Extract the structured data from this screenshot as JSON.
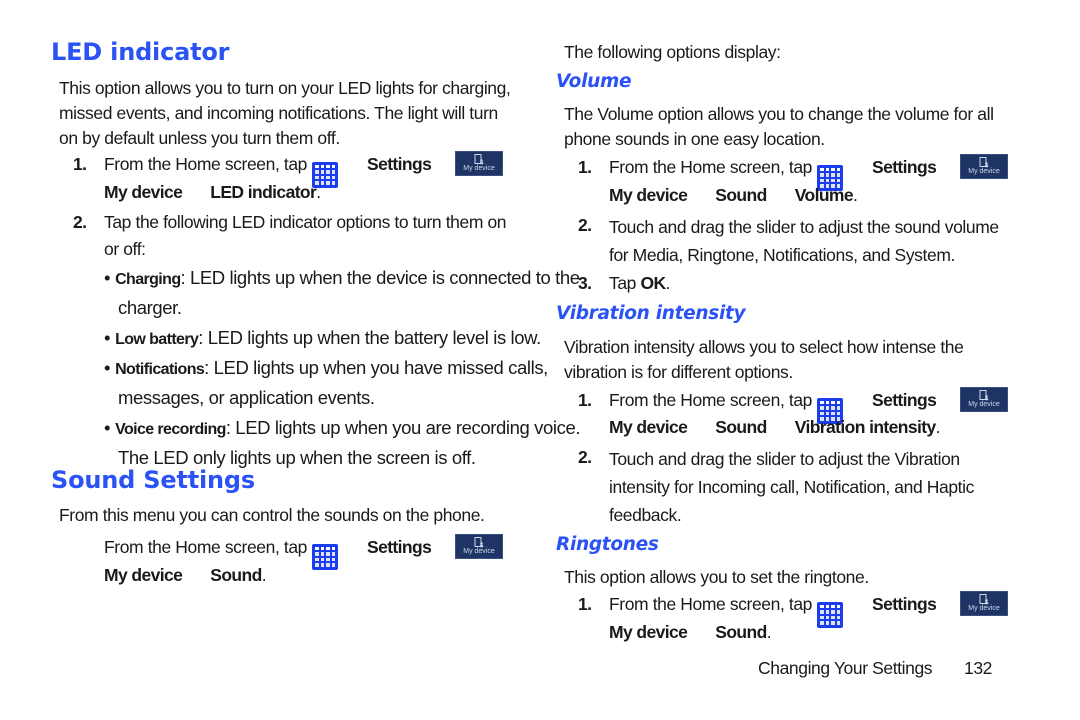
{
  "left": {
    "led": {
      "title": "LED indicator",
      "intro": [
        "This option allows you to turn on your LED lights for charging,",
        "missed events, and incoming notifications. The light will turn",
        "on by default unless you turn them off."
      ],
      "step1": {
        "num": "1.",
        "text": "From the Home screen, tap",
        "settings": "Settings",
        "path1": "My device",
        "path2": "LED indicator",
        "end": "."
      },
      "step2": {
        "num": "2.",
        "line1": "Tap the following LED indicator options to turn them on",
        "line2": "or off:"
      },
      "bullets": [
        {
          "term": "Charging",
          "line1": ": LED lights up when the device is connected to the",
          "line2": "charger."
        },
        {
          "term": "Low battery",
          "line1": ": LED lights up when the battery level is low.",
          "line2": ""
        },
        {
          "term": "Notifications",
          "line1": ": LED lights up when you have missed calls,",
          "line2": "messages, or application events."
        },
        {
          "term": "Voice recording",
          "line1": ": LED lights up when you are recording voice.",
          "line2": "The LED only lights up when the screen is off."
        }
      ]
    },
    "sound": {
      "title": "Sound Settings",
      "intro": "From this menu you can control the sounds on the phone.",
      "step": {
        "text": "From the Home screen, tap",
        "settings": "Settings",
        "path1": "My device",
        "path2": "Sound",
        "end": "."
      }
    }
  },
  "right": {
    "options_intro": "The following options display:",
    "volume": {
      "title": "Volume",
      "intro": [
        "The Volume option allows you to change the volume for all",
        "phone sounds in one easy location."
      ],
      "step1": {
        "num": "1.",
        "text": "From the Home screen, tap",
        "settings": "Settings",
        "path1": "My device",
        "path2": "Sound",
        "path3": "Volume",
        "end": "."
      },
      "step2": {
        "num": "2.",
        "line1": "Touch and drag the slider to adjust the sound volume",
        "line2": "for Media, Ringtone, Notifications, and System."
      },
      "step3": {
        "num": "3.",
        "text": "Tap ",
        "bold": "OK",
        "end": "."
      }
    },
    "vibration": {
      "title": "Vibration intensity",
      "intro": [
        "Vibration intensity allows you to select how intense the",
        "vibration is for different options."
      ],
      "step1": {
        "num": "1.",
        "text": "From the Home screen, tap",
        "settings": "Settings",
        "path1": "My device",
        "path2": "Sound",
        "path3": "Vibration intensity",
        "end": "."
      },
      "step2": {
        "num": "2.",
        "line1": "Touch and drag the slider to adjust the Vibration",
        "line2": "intensity for Incoming call, Notification, and Haptic",
        "line3": "feedback."
      }
    },
    "ringtones": {
      "title": "Ringtones",
      "intro": "This option allows you to set the ringtone.",
      "step1": {
        "num": "1.",
        "text": "From the Home screen, tap",
        "settings": "Settings",
        "path1": "My device",
        "path2": "Sound",
        "end": "."
      }
    }
  },
  "footer": {
    "chapter": "Changing Your Settings",
    "page": "132"
  },
  "icons": {
    "apps": "apps-grid-icon",
    "my_device": "my-device-icon",
    "my_device_label": "My device"
  },
  "colors": {
    "heading": "#2a52f5",
    "apps_icon": "#1b3df0",
    "my_device_bg": "#1e3464"
  }
}
